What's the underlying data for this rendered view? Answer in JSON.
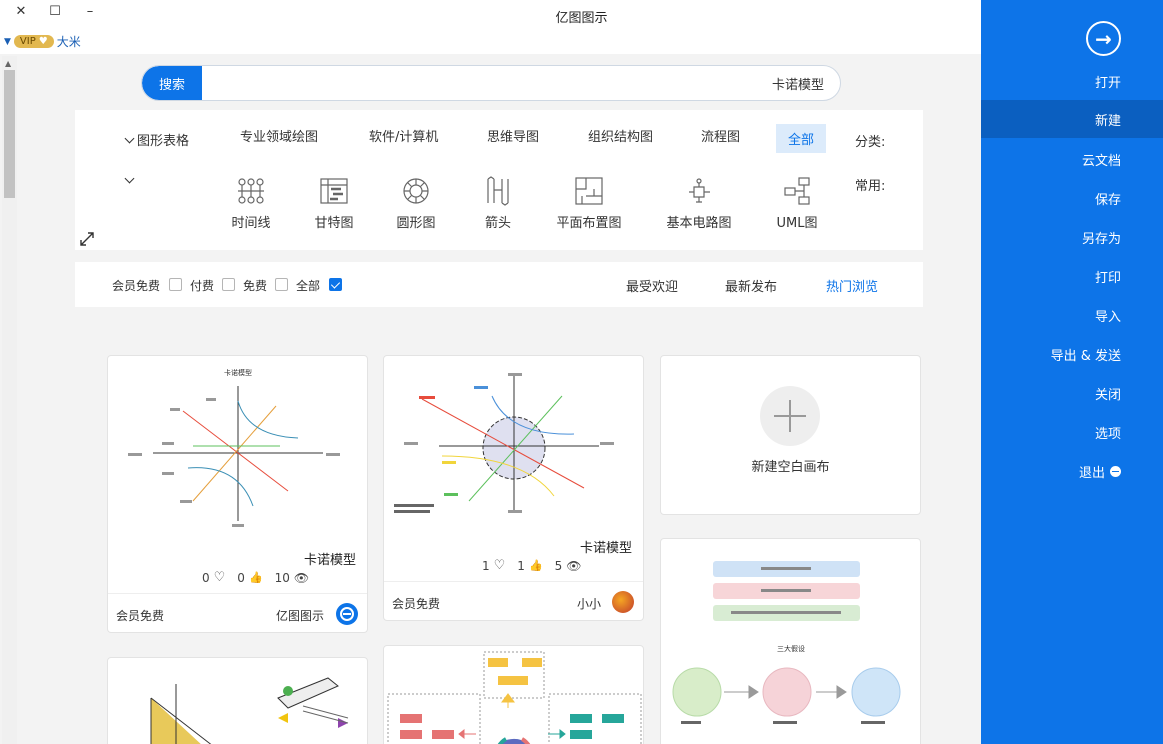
{
  "window": {
    "title": "亿图图示",
    "close": "✕",
    "maximize": "☐",
    "minimize": "–"
  },
  "user": {
    "vip": "VIP",
    "name": "大米"
  },
  "sidebar": {
    "items": [
      {
        "label": "打开"
      },
      {
        "label": "新建"
      },
      {
        "label": "云文档"
      },
      {
        "label": "保存"
      },
      {
        "label": "另存为"
      },
      {
        "label": "打印"
      },
      {
        "label": "导入"
      },
      {
        "label": "导出 & 发送"
      },
      {
        "label": "关闭"
      },
      {
        "label": "选项"
      },
      {
        "label": "退出"
      }
    ],
    "active_index": 1
  },
  "search": {
    "button": "搜索",
    "value": "卡诺模型"
  },
  "categories": {
    "label": "分类:",
    "items": [
      "全部",
      "流程图",
      "组织结构图",
      "思维导图",
      "软件/计算机",
      "专业领域绘图",
      "图形表格"
    ],
    "active": "全部"
  },
  "common": {
    "label": "常用:",
    "items": [
      "UML图",
      "基本电路图",
      "平面布置图",
      "箭头",
      "圆形图",
      "甘特图",
      "时间线"
    ]
  },
  "sort_tabs": [
    "热门浏览",
    "最新发布",
    "最受欢迎"
  ],
  "sort_active": "热门浏览",
  "price_filters": [
    {
      "label": "全部",
      "checked": true
    },
    {
      "label": "免费",
      "checked": false
    },
    {
      "label": "付费",
      "checked": false
    },
    {
      "label": "会员免费",
      "checked": false
    }
  ],
  "cards": {
    "blank": {
      "label": "新建空白画布"
    },
    "card1": {
      "title": "卡诺模型",
      "views": "5",
      "likes": "1",
      "favorites": "1",
      "author": "小小",
      "price": "会员免费"
    },
    "card2": {
      "title": "卡诺模型",
      "views": "10",
      "likes": "0",
      "favorites": "0",
      "author": "亿图图示",
      "price": "会员免费",
      "thumb_title": "卡诺模型"
    },
    "card3": {
      "title": "三大假设"
    }
  },
  "colors": {
    "accent": "#0d74e8",
    "sidebar": "#0d74e8",
    "vip": "#e2b850"
  }
}
